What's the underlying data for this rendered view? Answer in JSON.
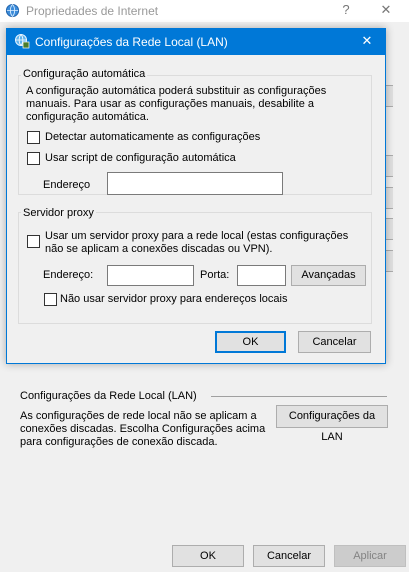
{
  "parent_window": {
    "title": "Propriedades de Internet",
    "help_glyph": "?",
    "close_glyph": "✕",
    "icon": "globe-icon",
    "lan_section": {
      "header": "Configurações da Rede Local (LAN)",
      "description": "As configurações de rede local não se aplicam a conexões discadas. Escolha Configurações acima para configurações de conexão discada.",
      "lan_button": "Configurações da LAN"
    },
    "footer": {
      "ok": "OK",
      "cancel": "Cancelar",
      "apply": "Aplicar"
    }
  },
  "dialog": {
    "title": "Configurações da Rede Local (LAN)",
    "icon": "network-settings-icon",
    "close_glyph": "✕",
    "title_bar_color": "#0078d7",
    "auto_config": {
      "legend": "Configuração automática",
      "description": "A configuração automática poderá substituir as configurações manuais. Para usar as configurações manuais, desabilite a configuração automática.",
      "detect_label": "Detectar automaticamente as configurações",
      "detect_checked": false,
      "script_label": "Usar script de configuração automática",
      "script_checked": false,
      "address_label": "Endereço",
      "address_value": ""
    },
    "proxy": {
      "legend": "Servidor proxy",
      "use_proxy_label": "Usar um servidor proxy para a rede local (estas configurações não se aplicam a conexões discadas ou VPN).",
      "use_proxy_checked": false,
      "address_label": "Endereço:",
      "address_value": "",
      "port_label": "Porta:",
      "port_value": "",
      "advanced_button": "Avançadas",
      "bypass_label": "Não usar servidor proxy para endereços locais",
      "bypass_checked": false
    },
    "ok": "OK",
    "cancel": "Cancelar"
  }
}
